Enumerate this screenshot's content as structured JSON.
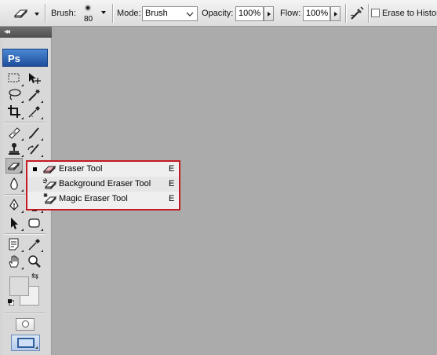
{
  "options_bar": {
    "brush_label": "Brush:",
    "brush_size": "80",
    "mode_label": "Mode:",
    "mode_value": "Brush",
    "opacity_label": "Opacity:",
    "opacity_value": "100%",
    "flow_label": "Flow:",
    "flow_value": "100%",
    "erase_to_history_label": "Erase to History",
    "erase_to_history_checked": false
  },
  "tools_panel": {
    "logo_text": "Ps",
    "active_tool": "eraser-tool"
  },
  "flyout": {
    "items": [
      {
        "label": "Eraser Tool",
        "shortcut": "E",
        "selected": true,
        "icon": "eraser-icon"
      },
      {
        "label": "Background Eraser Tool",
        "shortcut": "E",
        "selected": false,
        "icon": "background-eraser-icon"
      },
      {
        "label": "Magic Eraser Tool",
        "shortcut": "E",
        "selected": false,
        "icon": "magic-eraser-icon"
      }
    ],
    "highlight_color": "#c41b22"
  },
  "colors": {
    "canvas_background": "#ababab",
    "foreground_swatch": "#dcdcdc",
    "background_swatch": "#f0f0f0"
  }
}
